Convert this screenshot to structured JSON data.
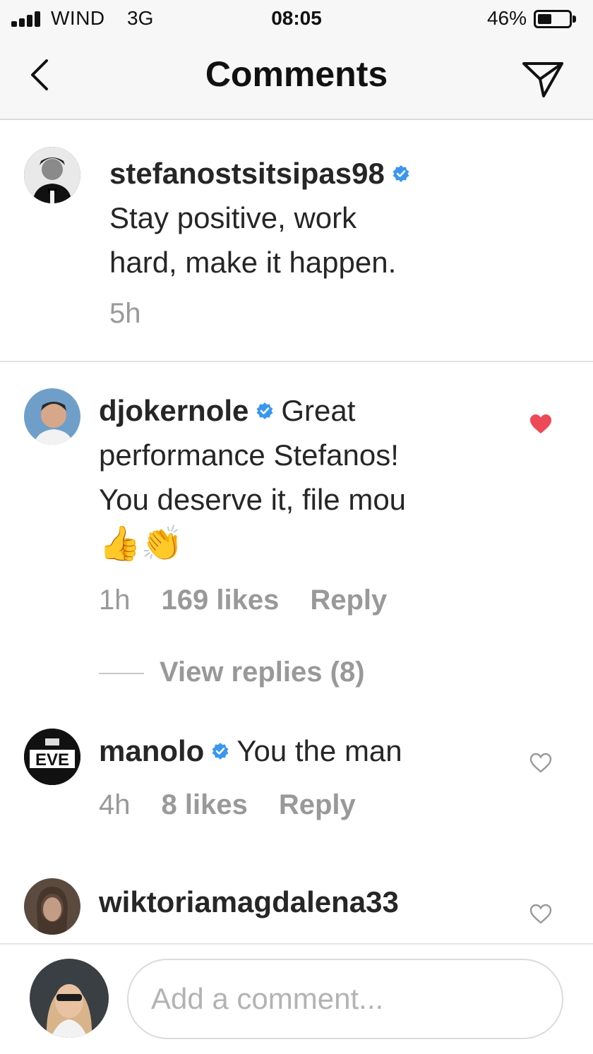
{
  "status_bar": {
    "carrier": "WIND",
    "network": "3G",
    "time": "08:05",
    "battery": "46%",
    "battery_level": 0.46
  },
  "header": {
    "title": "Comments",
    "back_icon": "chevron-left-icon",
    "send_icon": "paper-plane-icon"
  },
  "caption": {
    "username": "stefanostsitsipas98",
    "verified": true,
    "text_line1": "Stay positive, work",
    "text_line2": "hard, make it happen.",
    "time": "5h"
  },
  "comments": [
    {
      "username": "djokernole",
      "verified": true,
      "text_line1": "Great",
      "text_line2": "performance Stefanos!",
      "text_line3": "You deserve it, file mou",
      "emoji": "👍👏",
      "time": "1h",
      "likes": "169 likes",
      "reply": "Reply",
      "liked": true,
      "view_replies": "View replies (8)"
    },
    {
      "username": "manolo",
      "verified": true,
      "text": "You the man",
      "time": "4h",
      "likes": "8 likes",
      "reply": "Reply",
      "liked": false
    },
    {
      "username": "wiktoriamagdalena33"
    }
  ],
  "composer": {
    "placeholder": "Add a comment..."
  },
  "colors": {
    "verified": "#3897f0",
    "liked_heart": "#ed4956",
    "muted_text": "#999999"
  }
}
